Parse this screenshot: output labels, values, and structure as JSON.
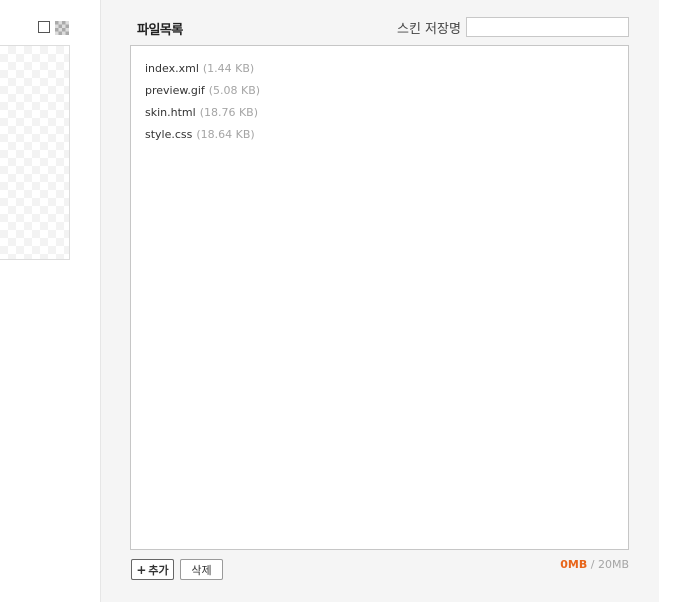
{
  "preview": {
    "toggle_plain_label": "",
    "toggle_checker_label": ""
  },
  "panel": {
    "title": "파일목록",
    "skin_name_label": "스킨 저장명",
    "skin_name_value": ""
  },
  "files": [
    {
      "name": "index.xml",
      "size": "(1.44 KB)"
    },
    {
      "name": "preview.gif",
      "size": "(5.08 KB)"
    },
    {
      "name": "skin.html",
      "size": "(18.76 KB)"
    },
    {
      "name": "style.css",
      "size": "(18.64 KB)"
    }
  ],
  "buttons": {
    "add_icon": "+",
    "add_label": "추가",
    "delete_label": "삭제"
  },
  "usage": {
    "used": "0MB",
    "separator": " / ",
    "limit": "20MB"
  },
  "colors": {
    "panel_bg": "#f5f5f5",
    "usage_accent": "#e8651a"
  }
}
